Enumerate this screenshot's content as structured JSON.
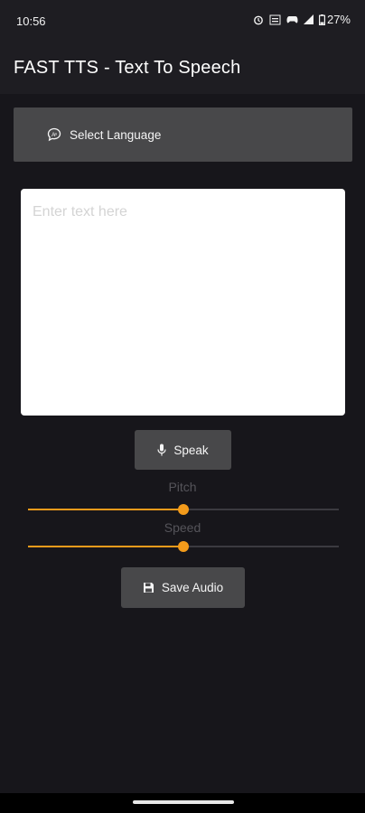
{
  "status_bar": {
    "time": "10:56",
    "battery": "27%",
    "icons": [
      "alarm-icon",
      "wifi-calling-icon",
      "game-controller-icon",
      "signal-icon",
      "battery-icon"
    ]
  },
  "app_bar": {
    "title": "FAST TTS - Text To Speech"
  },
  "language_button": {
    "label": "Select Language",
    "icon": "language-chat-icon"
  },
  "text_input": {
    "placeholder": "Enter text here",
    "value": ""
  },
  "speak_button": {
    "label": "Speak",
    "icon": "mic-icon"
  },
  "pitch": {
    "label": "Pitch",
    "value": 0.5
  },
  "speed": {
    "label": "Speed",
    "value": 0.5
  },
  "save_button": {
    "label": "Save Audio",
    "icon": "save-icon"
  },
  "colors": {
    "accent": "#f39b1b",
    "background": "#17161b",
    "button": "#48484a"
  }
}
